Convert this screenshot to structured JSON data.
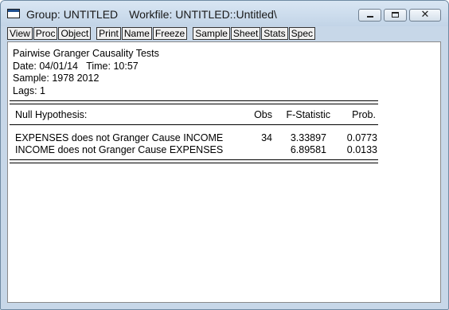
{
  "window": {
    "title_group": "Group: UNTITLED",
    "title_workfile": "Workfile: UNTITLED::Untitled\\",
    "icon": "eviews-window-icon",
    "controls": {
      "minimize": "minimize-icon",
      "maximize": "maximize-icon",
      "close_glyph": "✕"
    }
  },
  "toolbar": {
    "buttons": [
      "View",
      "Proc",
      "Object",
      "Print",
      "Name",
      "Freeze",
      "Sample",
      "Sheet",
      "Stats",
      "Spec"
    ]
  },
  "output": {
    "header": [
      "Pairwise Granger Causality Tests",
      "Date: 04/01/14   Time: 10:57",
      "Sample: 1978 2012",
      "Lags: 1"
    ],
    "table": {
      "columns": [
        "Null Hypothesis:",
        "Obs",
        "F-Statistic",
        "Prob."
      ],
      "rows": [
        {
          "hypothesis": "EXPENSES does not Granger Cause INCOME",
          "obs": "34",
          "f_stat": "3.33897",
          "prob": "0.0773"
        },
        {
          "hypothesis": "INCOME does not Granger Cause EXPENSES",
          "obs": "",
          "f_stat": "6.89581",
          "prob": "0.0133"
        }
      ]
    }
  }
}
